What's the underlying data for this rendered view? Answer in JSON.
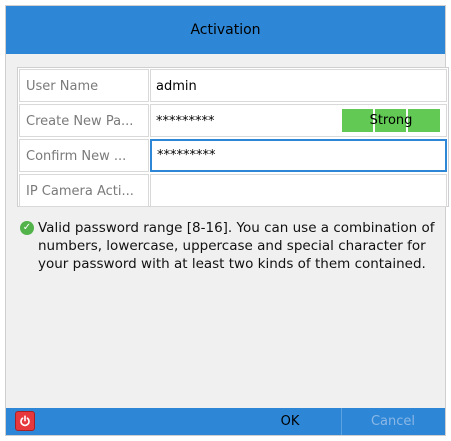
{
  "window": {
    "title": "Activation"
  },
  "form": {
    "rows": [
      {
        "label": "User Name",
        "value": "admin"
      },
      {
        "label": "Create New Pa...",
        "value": "*********",
        "strength": "Strong"
      },
      {
        "label": "Confirm New ...",
        "value": "*********"
      },
      {
        "label": "IP Camera Acti...",
        "value": ""
      }
    ]
  },
  "hint": {
    "icon": "check-circle-icon",
    "text": "Valid password range [8-16]. You can use a combination of numbers, lowercase, uppercase and special character for your password with at least two kinds of them contained."
  },
  "footer": {
    "power_icon": "power-icon",
    "ok_label": "OK",
    "cancel_label": "Cancel"
  },
  "colors": {
    "accent": "#2e87d6",
    "strength_strong": "#62c954",
    "power_red": "#e6383d",
    "check_green": "#52b34a"
  }
}
